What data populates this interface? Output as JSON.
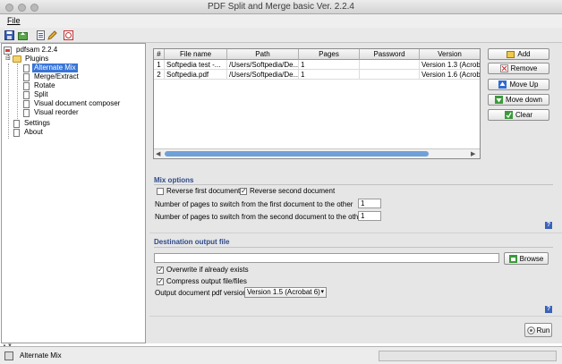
{
  "window": {
    "title": "PDF Split and Merge basic Ver. 2.2.4"
  },
  "menu": {
    "file": "File"
  },
  "toolbar": {
    "icons": [
      "save-icon",
      "load-icon",
      "pdf-icon",
      "edit-icon",
      "settings-icon"
    ]
  },
  "tree": {
    "root": "pdfsam 2.2.4",
    "plugins": "Plugins",
    "items": [
      "Alternate Mix",
      "Merge/Extract",
      "Rotate",
      "Split",
      "Visual document composer",
      "Visual reorder"
    ],
    "settings": "Settings",
    "about": "About",
    "selected": "Alternate Mix"
  },
  "table": {
    "headers": [
      "#",
      "File name",
      "Path",
      "Pages",
      "Password",
      "Version"
    ],
    "rows": [
      [
        "1",
        "Softpedia test -...",
        "/Users/Softpedia/De...",
        "1",
        "",
        "Version 1.3 (Acrobat..."
      ],
      [
        "2",
        "Softpedia.pdf",
        "/Users/Softpedia/De...",
        "1",
        "",
        "Version 1.6 (Acrobat..."
      ]
    ]
  },
  "buttons": {
    "add": "Add",
    "remove": "Remove",
    "move_up": "Move Up",
    "move_down": "Move down",
    "clear": "Clear",
    "browse": "Browse",
    "run": "Run"
  },
  "mix_options": {
    "title": "Mix options",
    "reverse_first": "Reverse first document",
    "reverse_first_checked": false,
    "reverse_second": "Reverse second document",
    "reverse_second_checked": true,
    "switch_first_label": "Number of pages to switch from the first document to the other",
    "switch_first_value": "1",
    "switch_second_label": "Number of pages to switch from the second document to the other",
    "switch_second_value": "1"
  },
  "destination": {
    "title": "Destination output file",
    "path_value": "",
    "overwrite": "Overwrite if already exists",
    "overwrite_checked": true,
    "compress": "Compress output file/files",
    "compress_checked": true,
    "version_label": "Output document pdf version:",
    "version_value": "Version 1.5 (Acrobat 6)"
  },
  "help_glyph": "?",
  "status": {
    "text": "Alternate Mix"
  },
  "colors": {
    "selection": "#3875d7",
    "section_title": "#2e4b8a",
    "scroll_thumb": "#6fa0d8"
  }
}
